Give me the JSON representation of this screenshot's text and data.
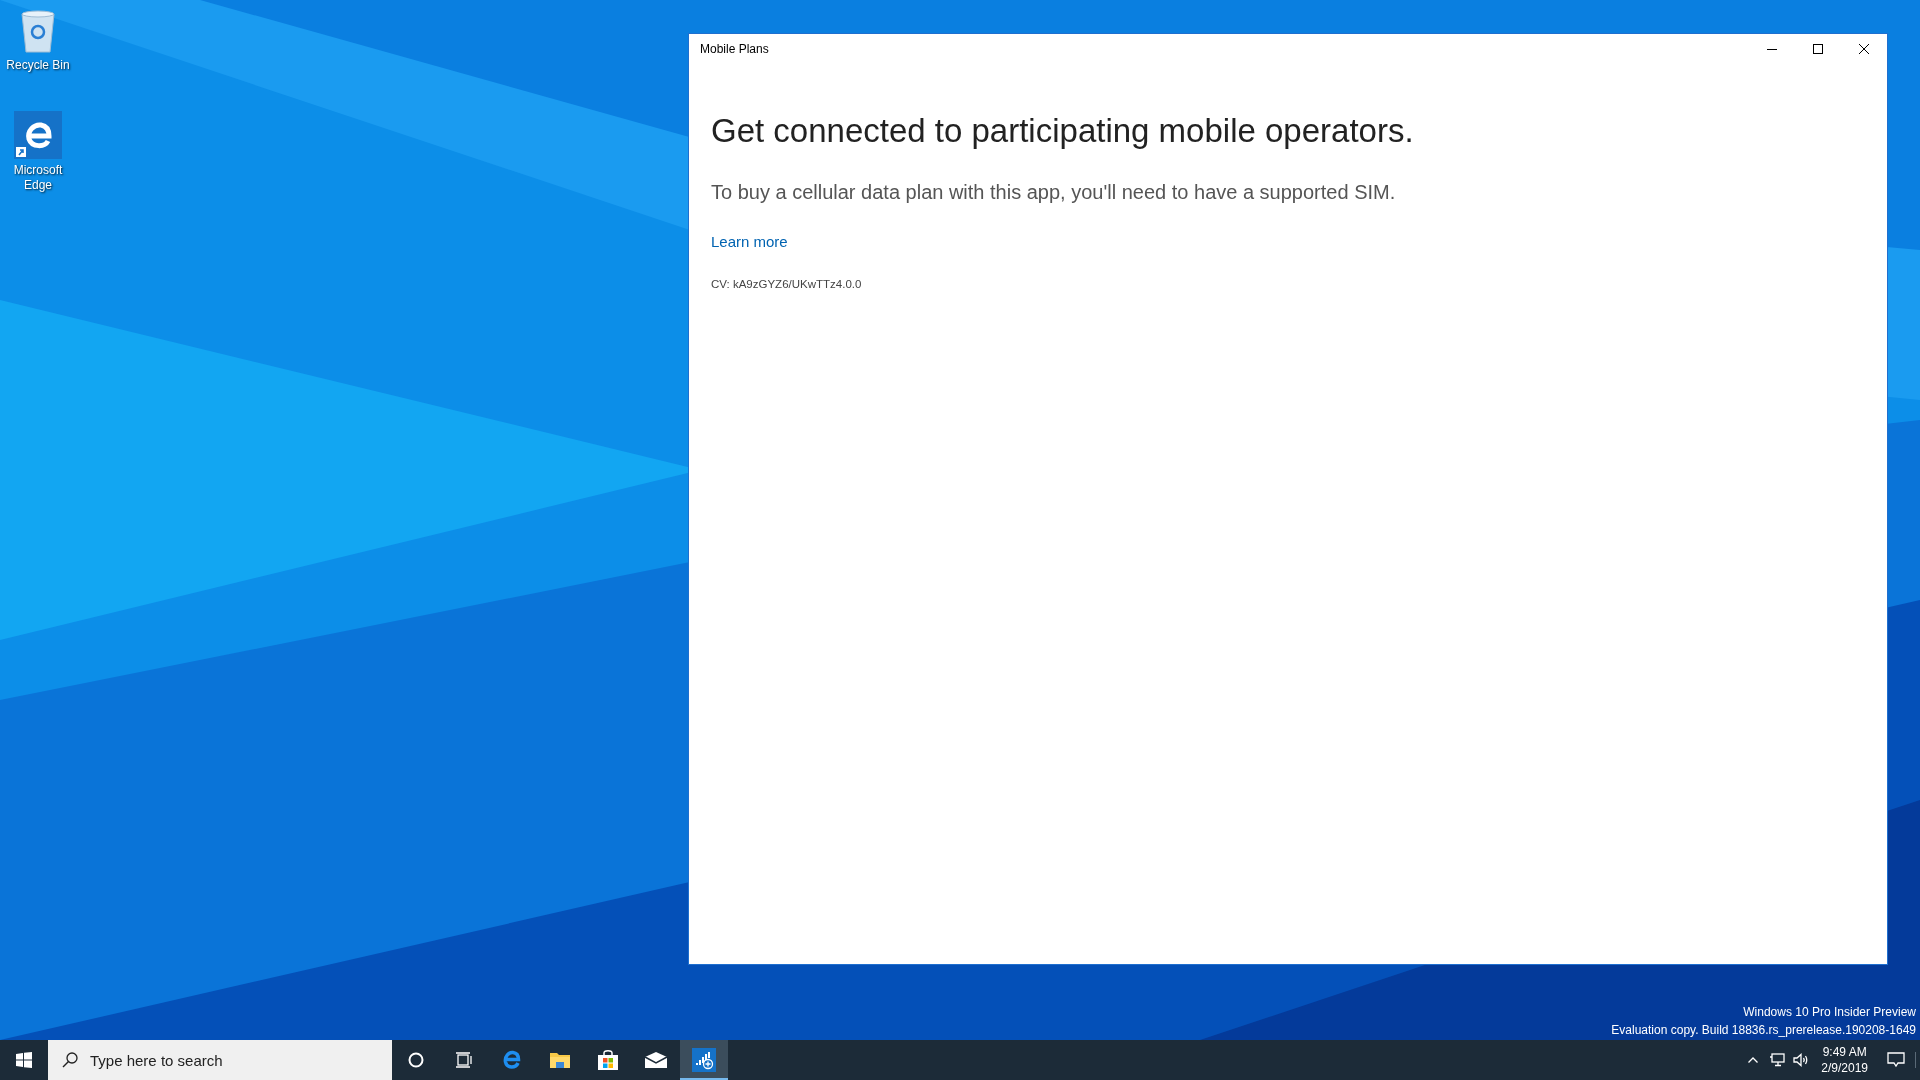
{
  "desktop_icons": [
    {
      "kind": "recycle",
      "label": "Recycle Bin"
    },
    {
      "kind": "browser",
      "label": "Microsoft Edge"
    }
  ],
  "window": {
    "title": "Mobile Plans",
    "heading": "Get connected to participating mobile operators.",
    "description": "To buy a cellular data plan with this app, you'll need to have a supported SIM.",
    "link": "Learn more",
    "version": "CV: kA9zGYZ6/UKwTTz4.0.0"
  },
  "os_notice": [
    "Windows 10 Pro Insider Preview",
    "Evaluation copy. Build 18836.rs_prerelease.190208-1649"
  ],
  "taskbar": {
    "search": {
      "placeholder": "Type here to search"
    },
    "apps": [
      {
        "kind": "cortana",
        "selected": false
      },
      {
        "kind": "taskview",
        "selected": false
      },
      {
        "kind": "browser",
        "selected": false
      },
      {
        "kind": "folder",
        "selected": false
      },
      {
        "kind": "store",
        "selected": false
      },
      {
        "kind": "mail",
        "selected": false
      },
      {
        "kind": "cellular",
        "selected": true
      }
    ],
    "clock": {
      "time": "9:49 AM",
      "date": "2/9/2019"
    }
  }
}
